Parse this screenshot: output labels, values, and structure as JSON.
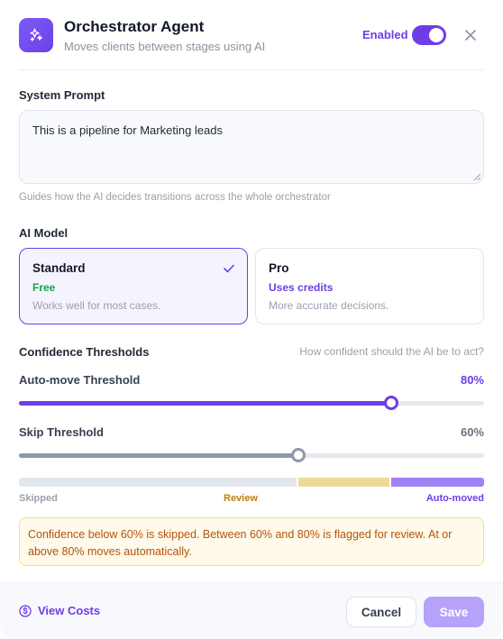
{
  "header": {
    "title": "Orchestrator Agent",
    "subtitle": "Moves clients between stages using AI",
    "enabled_label": "Enabled",
    "enabled": true,
    "icon": "sparkles-icon"
  },
  "system_prompt": {
    "label": "System Prompt",
    "value": "This is a pipeline for Marketing leads",
    "hint": "Guides how the AI decides transitions across the whole orchestrator"
  },
  "ai_model": {
    "label": "AI Model",
    "options": [
      {
        "name": "Standard",
        "tag": "Free",
        "description": "Works well for most cases.",
        "selected": true
      },
      {
        "name": "Pro",
        "tag": "Uses credits",
        "description": "More accurate decisions.",
        "selected": false
      }
    ]
  },
  "thresholds": {
    "label": "Confidence Thresholds",
    "hint": "How confident should the AI be to act?",
    "auto_move": {
      "label": "Auto-move Threshold",
      "value_text": "80%",
      "value": 80
    },
    "skip": {
      "label": "Skip Threshold",
      "value_text": "60%",
      "value": 60
    },
    "zones": {
      "skipped": "Skipped",
      "review": "Review",
      "auto_moved": "Auto-moved"
    },
    "notice": "Confidence below 60% is skipped. Between 60% and 80% is flagged for review. At or above 80% moves automatically."
  },
  "footer": {
    "view_costs": "View Costs",
    "cancel": "Cancel",
    "save": "Save"
  },
  "colors": {
    "accent": "#6d3ee8",
    "free": "#16a34a",
    "skip_track": "#8e99a8",
    "zone_skipped": "#e2e6ed",
    "zone_review": "#efd99a",
    "zone_auto": "#a281f7",
    "review_label": "#c07f0c",
    "auto_label": "#6d3ee8",
    "skipped_label": "#9aa1ad",
    "save_disabled": "#b6a2fb"
  }
}
